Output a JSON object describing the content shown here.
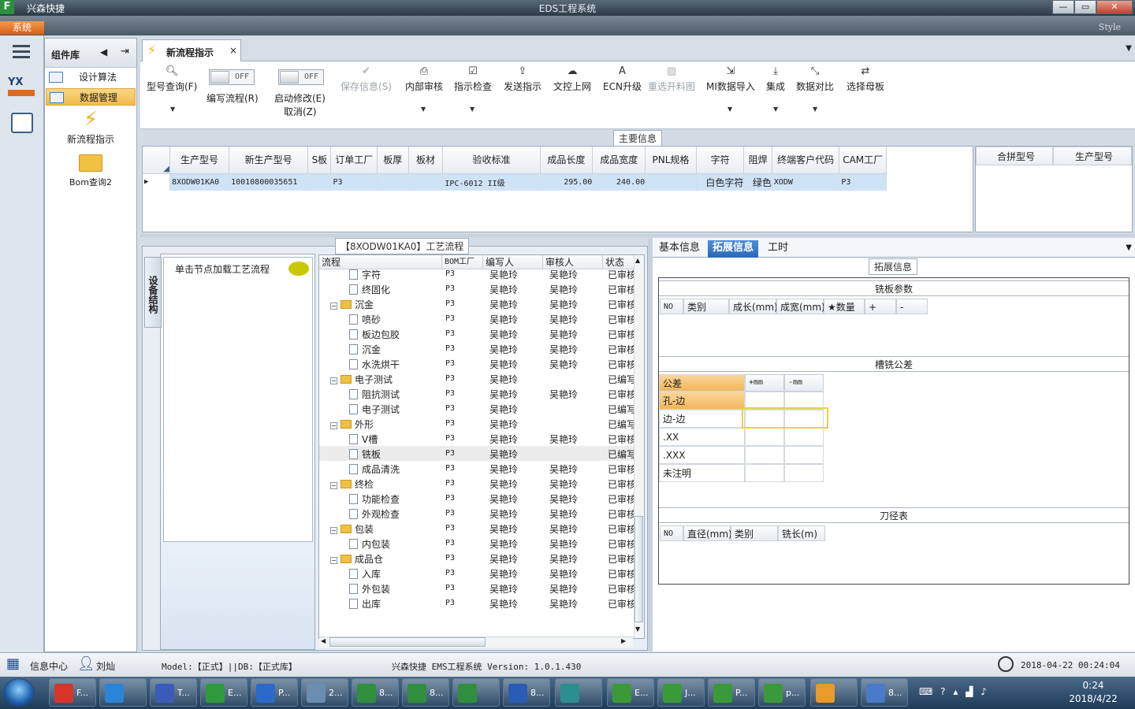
{
  "window": {
    "app_name": "兴森快捷",
    "title": "EDS工程系统",
    "min": "—",
    "max": "▭",
    "close": "✕"
  },
  "menu": {
    "system": "系统",
    "style": "Style"
  },
  "components": {
    "title": "组件库",
    "items": [
      {
        "label": "设计算法"
      },
      {
        "label": "数据管理"
      }
    ],
    "actions": [
      {
        "label": "新流程指示"
      },
      {
        "label": "Bom查询2"
      }
    ]
  },
  "tab": {
    "label": "新流程指示",
    "close": "×"
  },
  "toolbar": {
    "query": "型号查询(F)",
    "edit_flow": "编写流程(R)",
    "edit_flow_state": "OFF",
    "start_modify": "启动修改(E)",
    "cancel": "取消(Z)",
    "start_modify_state": "OFF",
    "save_info": "保存信息(S)",
    "internal_review": "内部审核",
    "instruction_check": "指示检查",
    "send_instruction": "发送指示",
    "upload": "文控上网",
    "ecn_upgrade": "ECN升级",
    "reselect": "重选开料图",
    "mi_import": "MI数据导入",
    "integrate": "集成",
    "data_compare": "数据对比",
    "select_master": "选择母板"
  },
  "main_info": {
    "title": "主要信息",
    "columns": [
      "生产型号",
      "新生产型号",
      "S板",
      "订单工厂",
      "板厚",
      "板材",
      "验收标准",
      "成品长度",
      "成品宽度",
      "PNL规格",
      "字符",
      "阻焊",
      "终端客户代码",
      "CAM工厂"
    ],
    "row": [
      "8XODW01KA0",
      "10010800035651",
      "",
      "P3",
      "",
      "",
      "IPC-6012 II级",
      "295.00",
      "240.00",
      "",
      "白色字符",
      "绿色",
      "XODW",
      "P3"
    ],
    "side_columns": [
      "合拼型号",
      "生产型号"
    ]
  },
  "flow": {
    "title": "【8XODW01KA0】工艺流程",
    "vertical_tab": "设备结构",
    "node_hint": "单击节点加载工艺流程",
    "columns": [
      "流程",
      "BOM工厂",
      "编写人",
      "审核人",
      "状态"
    ],
    "rows": [
      {
        "name": "字符",
        "level": 2,
        "bom": "P3",
        "writer": "吴艳玲",
        "reviewer": "吴艳玲",
        "status": "已审核"
      },
      {
        "name": "终固化",
        "level": 2,
        "bom": "P3",
        "writer": "吴艳玲",
        "reviewer": "吴艳玲",
        "status": "已审核"
      },
      {
        "name": "沉金",
        "level": 1,
        "bom": "P3",
        "writer": "吴艳玲",
        "reviewer": "吴艳玲",
        "status": "已审核"
      },
      {
        "name": "喷砂",
        "level": 2,
        "bom": "P3",
        "writer": "吴艳玲",
        "reviewer": "吴艳玲",
        "status": "已审核"
      },
      {
        "name": "板边包胶",
        "level": 2,
        "bom": "P3",
        "writer": "吴艳玲",
        "reviewer": "吴艳玲",
        "status": "已审核"
      },
      {
        "name": "沉金",
        "level": 2,
        "bom": "P3",
        "writer": "吴艳玲",
        "reviewer": "吴艳玲",
        "status": "已审核"
      },
      {
        "name": "水洗烘干",
        "level": 2,
        "bom": "P3",
        "writer": "吴艳玲",
        "reviewer": "吴艳玲",
        "status": "已审核"
      },
      {
        "name": "电子测试",
        "level": 1,
        "bom": "P3",
        "writer": "吴艳玲",
        "reviewer": "",
        "status": "已编写"
      },
      {
        "name": "阻抗测试",
        "level": 2,
        "bom": "P3",
        "writer": "吴艳玲",
        "reviewer": "吴艳玲",
        "status": "已审核"
      },
      {
        "name": "电子测试",
        "level": 2,
        "bom": "P3",
        "writer": "吴艳玲",
        "reviewer": "",
        "status": "已编写"
      },
      {
        "name": "外形",
        "level": 1,
        "bom": "P3",
        "writer": "吴艳玲",
        "reviewer": "",
        "status": "已编写"
      },
      {
        "name": "V槽",
        "level": 2,
        "bom": "P3",
        "writer": "吴艳玲",
        "reviewer": "吴艳玲",
        "status": "已审核"
      },
      {
        "name": "铣板",
        "level": 2,
        "bom": "P3",
        "writer": "吴艳玲",
        "reviewer": "",
        "status": "已编写",
        "selected": true
      },
      {
        "name": "成品清洗",
        "level": 2,
        "bom": "P3",
        "writer": "吴艳玲",
        "reviewer": "吴艳玲",
        "status": "已审核"
      },
      {
        "name": "终检",
        "level": 1,
        "bom": "P3",
        "writer": "吴艳玲",
        "reviewer": "吴艳玲",
        "status": "已审核"
      },
      {
        "name": "功能检查",
        "level": 2,
        "bom": "P3",
        "writer": "吴艳玲",
        "reviewer": "吴艳玲",
        "status": "已审核"
      },
      {
        "name": "外观检查",
        "level": 2,
        "bom": "P3",
        "writer": "吴艳玲",
        "reviewer": "吴艳玲",
        "status": "已审核"
      },
      {
        "name": "包装",
        "level": 1,
        "bom": "P3",
        "writer": "吴艳玲",
        "reviewer": "吴艳玲",
        "status": "已审核"
      },
      {
        "name": "内包装",
        "level": 2,
        "bom": "P3",
        "writer": "吴艳玲",
        "reviewer": "吴艳玲",
        "status": "已审核"
      },
      {
        "name": "成品仓",
        "level": 1,
        "bom": "P3",
        "writer": "吴艳玲",
        "reviewer": "吴艳玲",
        "status": "已审核"
      },
      {
        "name": "入库",
        "level": 2,
        "bom": "P3",
        "writer": "吴艳玲",
        "reviewer": "吴艳玲",
        "status": "已审核"
      },
      {
        "name": "外包装",
        "level": 2,
        "bom": "P3",
        "writer": "吴艳玲",
        "reviewer": "吴艳玲",
        "status": "已审核"
      },
      {
        "name": "出库",
        "level": 2,
        "bom": "P3",
        "writer": "吴艳玲",
        "reviewer": "吴艳玲",
        "status": "已审核"
      }
    ]
  },
  "detail": {
    "tabs": [
      {
        "label": "基本信息"
      },
      {
        "label": "拓展信息",
        "active": true
      },
      {
        "label": "工时"
      }
    ],
    "title": "拓展信息",
    "milling_params": {
      "title": "铣板参数",
      "columns": [
        "NO",
        "类别",
        "成长(mm)",
        "成宽(mm)",
        "★数量",
        "+",
        "-"
      ]
    },
    "tolerance": {
      "title": "槽铣公差",
      "header": [
        "公差",
        "+mm",
        "-mm"
      ],
      "rows": [
        "孔-边",
        "边-边",
        ".XX",
        ".XXX",
        "未注明"
      ]
    },
    "tool_table": {
      "title": "刀径表",
      "columns": [
        "NO",
        "直径(mm)",
        "类别",
        "铣长(m)"
      ]
    }
  },
  "status": {
    "info_center": "信息中心",
    "user": "刘灿",
    "model": "Model:【正式】||DB:【正式库】",
    "version": "兴森快捷 EMS工程系统 Version: 1.0.1.430",
    "datetime": "2018-04-22 00:24:04"
  },
  "taskbar": {
    "items": [
      {
        "label": "F..."
      },
      {
        "label": ""
      },
      {
        "label": "T..."
      },
      {
        "label": "E..."
      },
      {
        "label": "P..."
      },
      {
        "label": "2..."
      },
      {
        "label": "8..."
      },
      {
        "label": "8..."
      },
      {
        "label": ""
      },
      {
        "label": "8..."
      },
      {
        "label": ""
      },
      {
        "label": "E..."
      },
      {
        "label": "J..."
      },
      {
        "label": "P..."
      },
      {
        "label": "p..."
      },
      {
        "label": ""
      },
      {
        "label": "8..."
      }
    ],
    "time": "0:24",
    "date": "2018/4/22"
  }
}
